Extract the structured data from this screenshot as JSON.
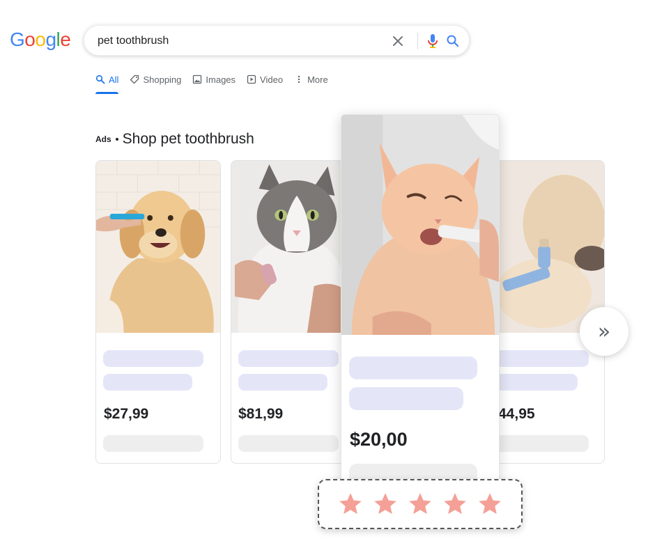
{
  "google_logo": {
    "letters": [
      {
        "char": "G",
        "color": "#4285F4"
      },
      {
        "char": "o",
        "color": "#EA4335"
      },
      {
        "char": "o",
        "color": "#FBBC05"
      },
      {
        "char": "g",
        "color": "#4285F4"
      },
      {
        "char": "l",
        "color": "#34A853"
      },
      {
        "char": "e",
        "color": "#EA4335"
      }
    ]
  },
  "search": {
    "query": "pet toothbrush",
    "clear_icon": "close-icon",
    "voice_icon": "microphone-icon",
    "search_icon": "magnifier-icon"
  },
  "tabs": [
    {
      "label": "All",
      "icon": "search-icon",
      "active": true
    },
    {
      "label": "Shopping",
      "icon": "tag-icon",
      "active": false
    },
    {
      "label": "Images",
      "icon": "image-icon",
      "active": false
    },
    {
      "label": "Video",
      "icon": "play-icon",
      "active": false
    },
    {
      "label": "More",
      "icon": "more-vertical-icon",
      "active": false
    }
  ],
  "ads": {
    "label": "Ads",
    "title": "Shop pet toothbrush"
  },
  "products": [
    {
      "price": "$27,99",
      "image": "golden-retriever-toothbrush"
    },
    {
      "price": "$81,99",
      "image": "tabby-cat-finger-brush"
    },
    {
      "price": "$20,00",
      "image": "ginger-cat-toothbrush",
      "highlighted": true
    },
    {
      "price": "44,95",
      "image": "blurred-dog-toothbrush"
    }
  ],
  "carousel": {
    "next_icon": "double-chevron-right-icon",
    "next_glyph": "»"
  },
  "rating": {
    "stars": 5,
    "color": "#f4a097"
  },
  "colors": {
    "accent": "#1a73e8",
    "placeholder_title": "#e4e6f8",
    "placeholder_meta": "#eeeeee"
  }
}
